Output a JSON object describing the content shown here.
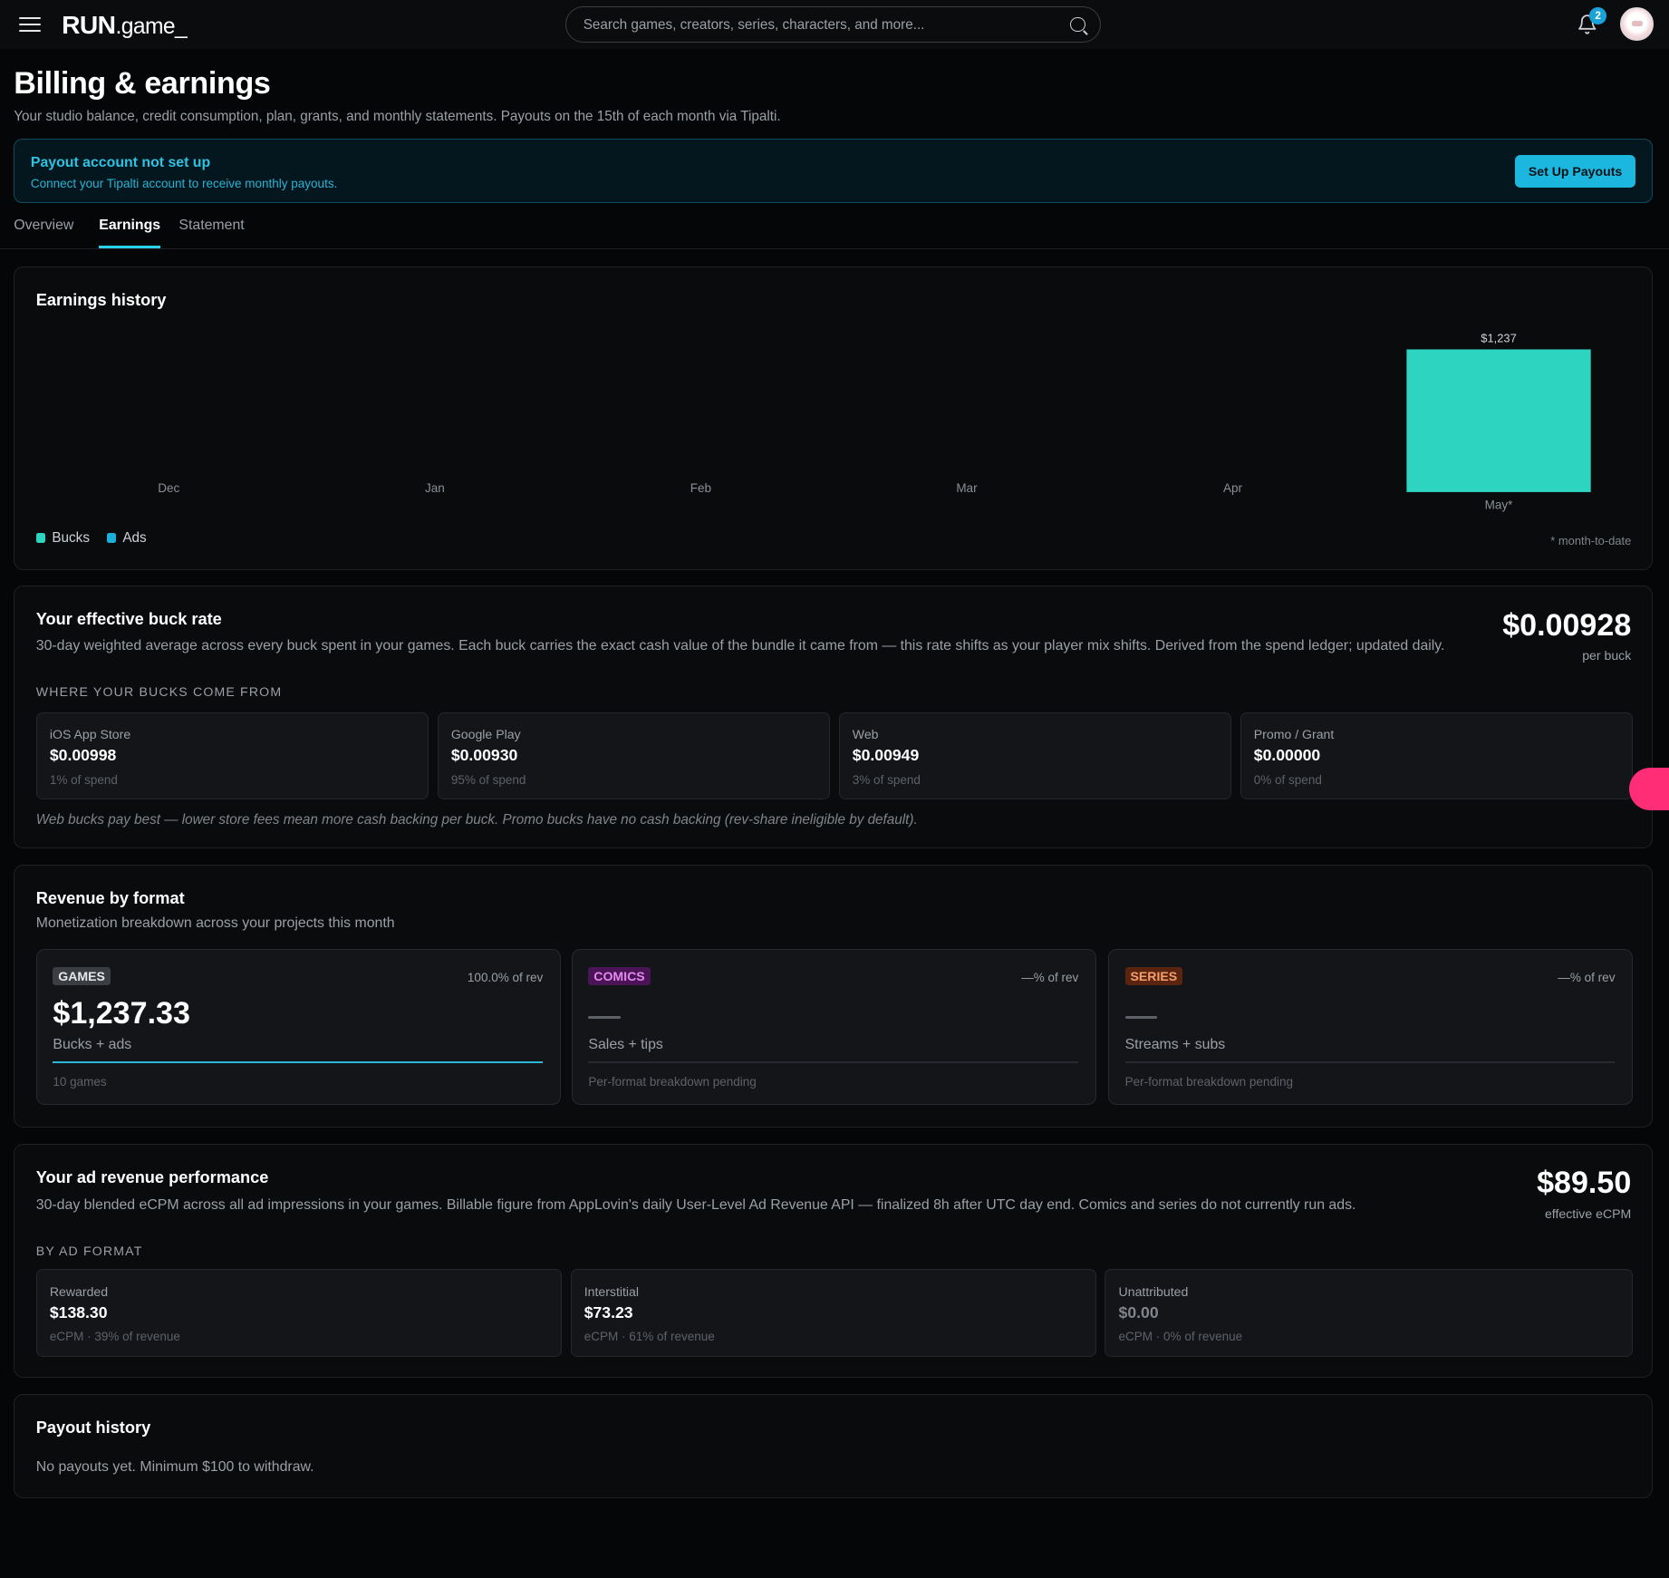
{
  "app": {
    "logo_main": "RUN",
    "logo_sub": ".game_",
    "search_placeholder": "Search games, creators, series, characters, and more...",
    "notification_count": "2"
  },
  "header": {
    "title": "Billing & earnings",
    "subtitle": "Your studio balance, credit consumption, plan, grants, and monthly statements. Payouts on the 15th of each month via Tipalti."
  },
  "alert": {
    "title": "Payout account not set up",
    "subtitle": "Connect your Tipalti account to receive monthly payouts.",
    "button": "Set Up Payouts"
  },
  "tabs": [
    {
      "label": "Overview",
      "active": false
    },
    {
      "label": "Earnings",
      "active": true
    },
    {
      "label": "Statement",
      "active": false
    }
  ],
  "earnings_history": {
    "title": "Earnings history",
    "legend": [
      {
        "label": "Bucks",
        "color": "#2dd4bf"
      },
      {
        "label": "Ads",
        "color": "#1ab0d8"
      }
    ],
    "footnote": "* month-to-date"
  },
  "chart_data": {
    "type": "bar",
    "title": "Earnings history",
    "categories": [
      "Dec",
      "Jan",
      "Feb",
      "Mar",
      "Apr",
      "May*"
    ],
    "series": [
      {
        "name": "Bucks",
        "values": [
          0,
          0,
          0,
          0,
          0,
          1237
        ]
      },
      {
        "name": "Ads",
        "values": [
          0,
          0,
          0,
          0,
          0,
          0
        ]
      }
    ],
    "data_labels": [
      "",
      "",
      "",
      "",
      "",
      "$1,237"
    ],
    "ylim": [
      0,
      1237
    ],
    "grid": false,
    "legend_position": "bottom-left",
    "colors": {
      "Bucks": "#2dd4bf",
      "Ads": "#1ab0d8"
    }
  },
  "buck_rate": {
    "title": "Your effective buck rate",
    "description": "30-day weighted average across every buck spent in your games. Each buck carries the exact cash value of the bundle it came from — this rate shifts as your player mix shifts. Derived from the spend ledger; updated daily.",
    "value": "$0.00928",
    "value_caption": "per buck",
    "section_label": "WHERE YOUR BUCKS COME FROM",
    "sources": [
      {
        "label": "iOS App Store",
        "value": "$0.00998",
        "foot": "1% of spend"
      },
      {
        "label": "Google Play",
        "value": "$0.00930",
        "foot": "95% of spend"
      },
      {
        "label": "Web",
        "value": "$0.00949",
        "foot": "3% of spend"
      },
      {
        "label": "Promo / Grant",
        "value": "$0.00000",
        "foot": "0% of spend"
      }
    ],
    "note": "Web bucks pay best — lower store fees mean more cash backing per buck. Promo bucks have no cash backing (rev-share ineligible by default)."
  },
  "revenue_format": {
    "title": "Revenue by format",
    "subtitle": "Monetization breakdown across your projects this month",
    "formats": [
      {
        "tag": "GAMES",
        "pct": "100.0% of rev",
        "amount": "$1,237.33",
        "sub": "Bucks + ads",
        "foot": "10 games",
        "share": 1.0,
        "tag_bg": "#3a3d42",
        "tag_fg": "#e6e8ea"
      },
      {
        "tag": "COMICS",
        "pct": "—% of rev",
        "amount": "",
        "sub": "Sales + tips",
        "foot": "Per-format breakdown pending",
        "share": 0,
        "tag_bg": "#4a1456",
        "tag_fg": "#e28af0"
      },
      {
        "tag": "SERIES",
        "pct": "—% of rev",
        "amount": "",
        "sub": "Streams + subs",
        "foot": "Per-format breakdown pending",
        "share": 0,
        "tag_bg": "#5a2410",
        "tag_fg": "#f5a06a"
      }
    ]
  },
  "ad_revenue": {
    "title": "Your ad revenue performance",
    "description": "30-day blended eCPM across all ad impressions in your games. Billable figure from AppLovin's daily User-Level Ad Revenue API — finalized 8h after UTC day end. Comics and series do not currently run ads.",
    "value": "$89.50",
    "value_caption": "effective eCPM",
    "section_label": "BY AD FORMAT",
    "formats": [
      {
        "label": "Rewarded",
        "value": "$138.30",
        "foot": "eCPM · 39% of revenue"
      },
      {
        "label": "Interstitial",
        "value": "$73.23",
        "foot": "eCPM · 61% of revenue"
      },
      {
        "label": "Unattributed",
        "value": "$0.00",
        "foot": "eCPM · 0% of revenue"
      }
    ]
  },
  "payout_history": {
    "title": "Payout history",
    "empty": "No payouts yet. Minimum $100 to withdraw."
  }
}
